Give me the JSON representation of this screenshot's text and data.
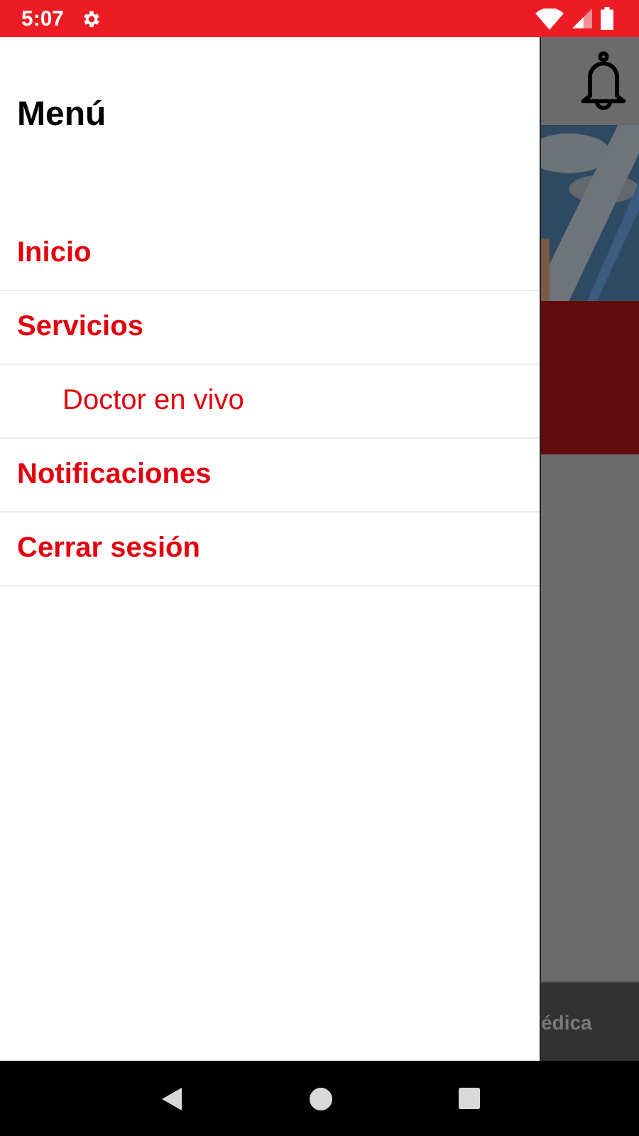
{
  "status_bar": {
    "time": "5:07"
  },
  "drawer": {
    "title": "Menú",
    "items": [
      {
        "label": "Inicio"
      },
      {
        "label": "Servicios",
        "children": [
          {
            "label": "Doctor en vivo"
          }
        ]
      },
      {
        "label": "Notificaciones"
      },
      {
        "label": "Cerrar sesión"
      }
    ]
  },
  "background_app": {
    "bottom_tab": "édica"
  }
}
